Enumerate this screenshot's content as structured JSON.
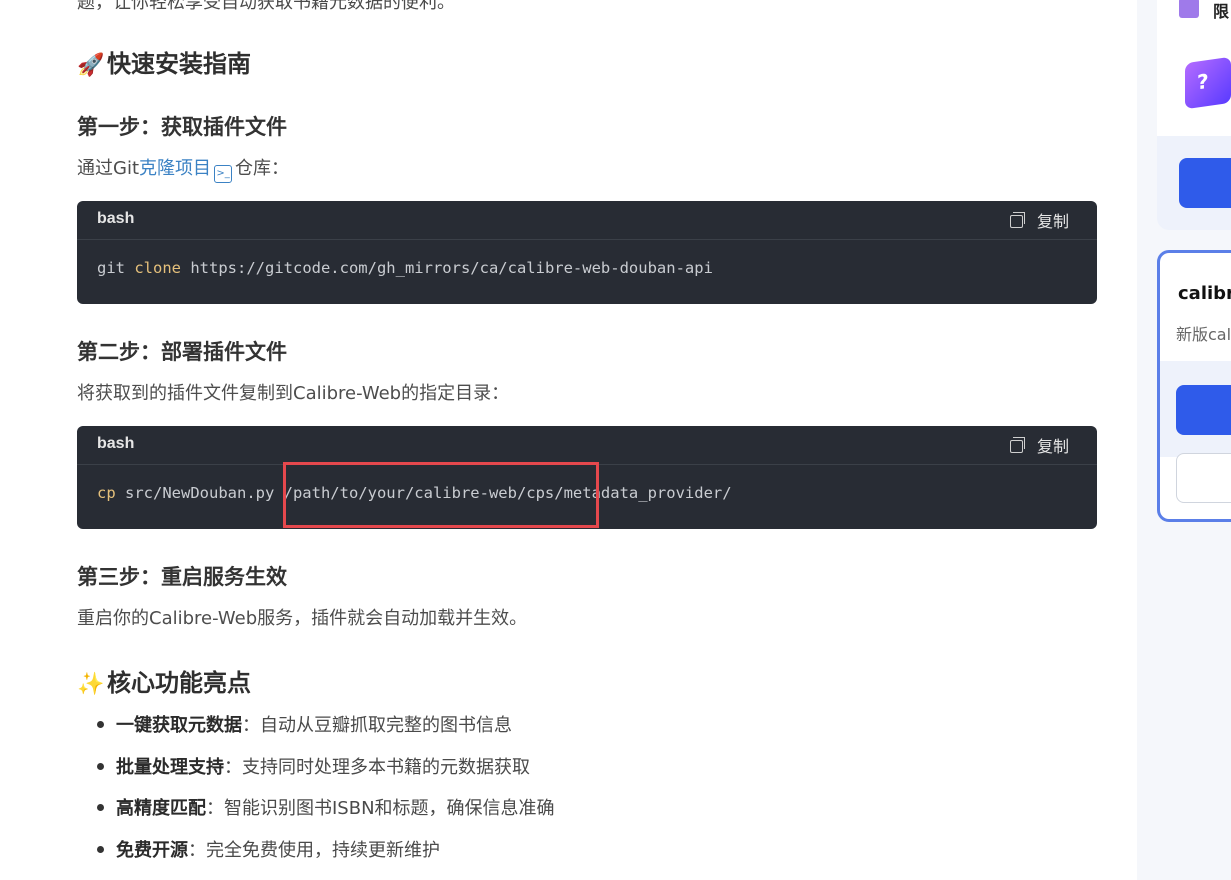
{
  "article": {
    "cut_line": "题，让你轻松享受自动获取书籍元数据的便利。",
    "install_heading": "快速安装指南",
    "install_emoji": "🚀",
    "step1_heading": "第一步：获取插件文件",
    "step1_text_before": "通过Git",
    "step1_link": "克隆项目",
    "step1_text_after": "仓库：",
    "code1": {
      "lang": "bash",
      "copy_label": "复制",
      "kw": "clone",
      "cmd_start": "git ",
      "cmd_rest": " https://gitcode.com/gh_mirrors/ca/calibre-web-douban-api"
    },
    "step2_heading": "第二步：部署插件文件",
    "step2_text": "将获取到的插件文件复制到Calibre-Web的指定目录：",
    "code2": {
      "lang": "bash",
      "copy_label": "复制",
      "kw": "cp",
      "cmd_rest": " src/NewDouban.py /path/to/your/calibre-web/cps/metadata_provider/"
    },
    "step3_heading": "第三步：重启服务生效",
    "step3_text": "重启你的Calibre-Web服务，插件就会自动加载并生效。",
    "features_heading": "核心功能亮点",
    "features_emoji": "✨",
    "features": [
      {
        "bold": "一键获取元数据",
        "text": "：自动从豆瓣抓取完整的图书信息"
      },
      {
        "bold": "批量处理支持",
        "text": "：支持同时处理多本书籍的元数据获取"
      },
      {
        "bold": "高精度匹配",
        "text": "：智能识别图书ISBN和标题，确保信息准确"
      },
      {
        "bold": "免费开源",
        "text": "：完全免费使用，持续更新维护"
      }
    ]
  },
  "sidebar": {
    "promo_label": "限",
    "card_title": "calibre",
    "card_subtitle": "新版cal"
  },
  "colors": {
    "accent": "#2f5bea",
    "highlight": "#e5484d",
    "link": "#3b82c4",
    "code_bg": "#282c34"
  }
}
